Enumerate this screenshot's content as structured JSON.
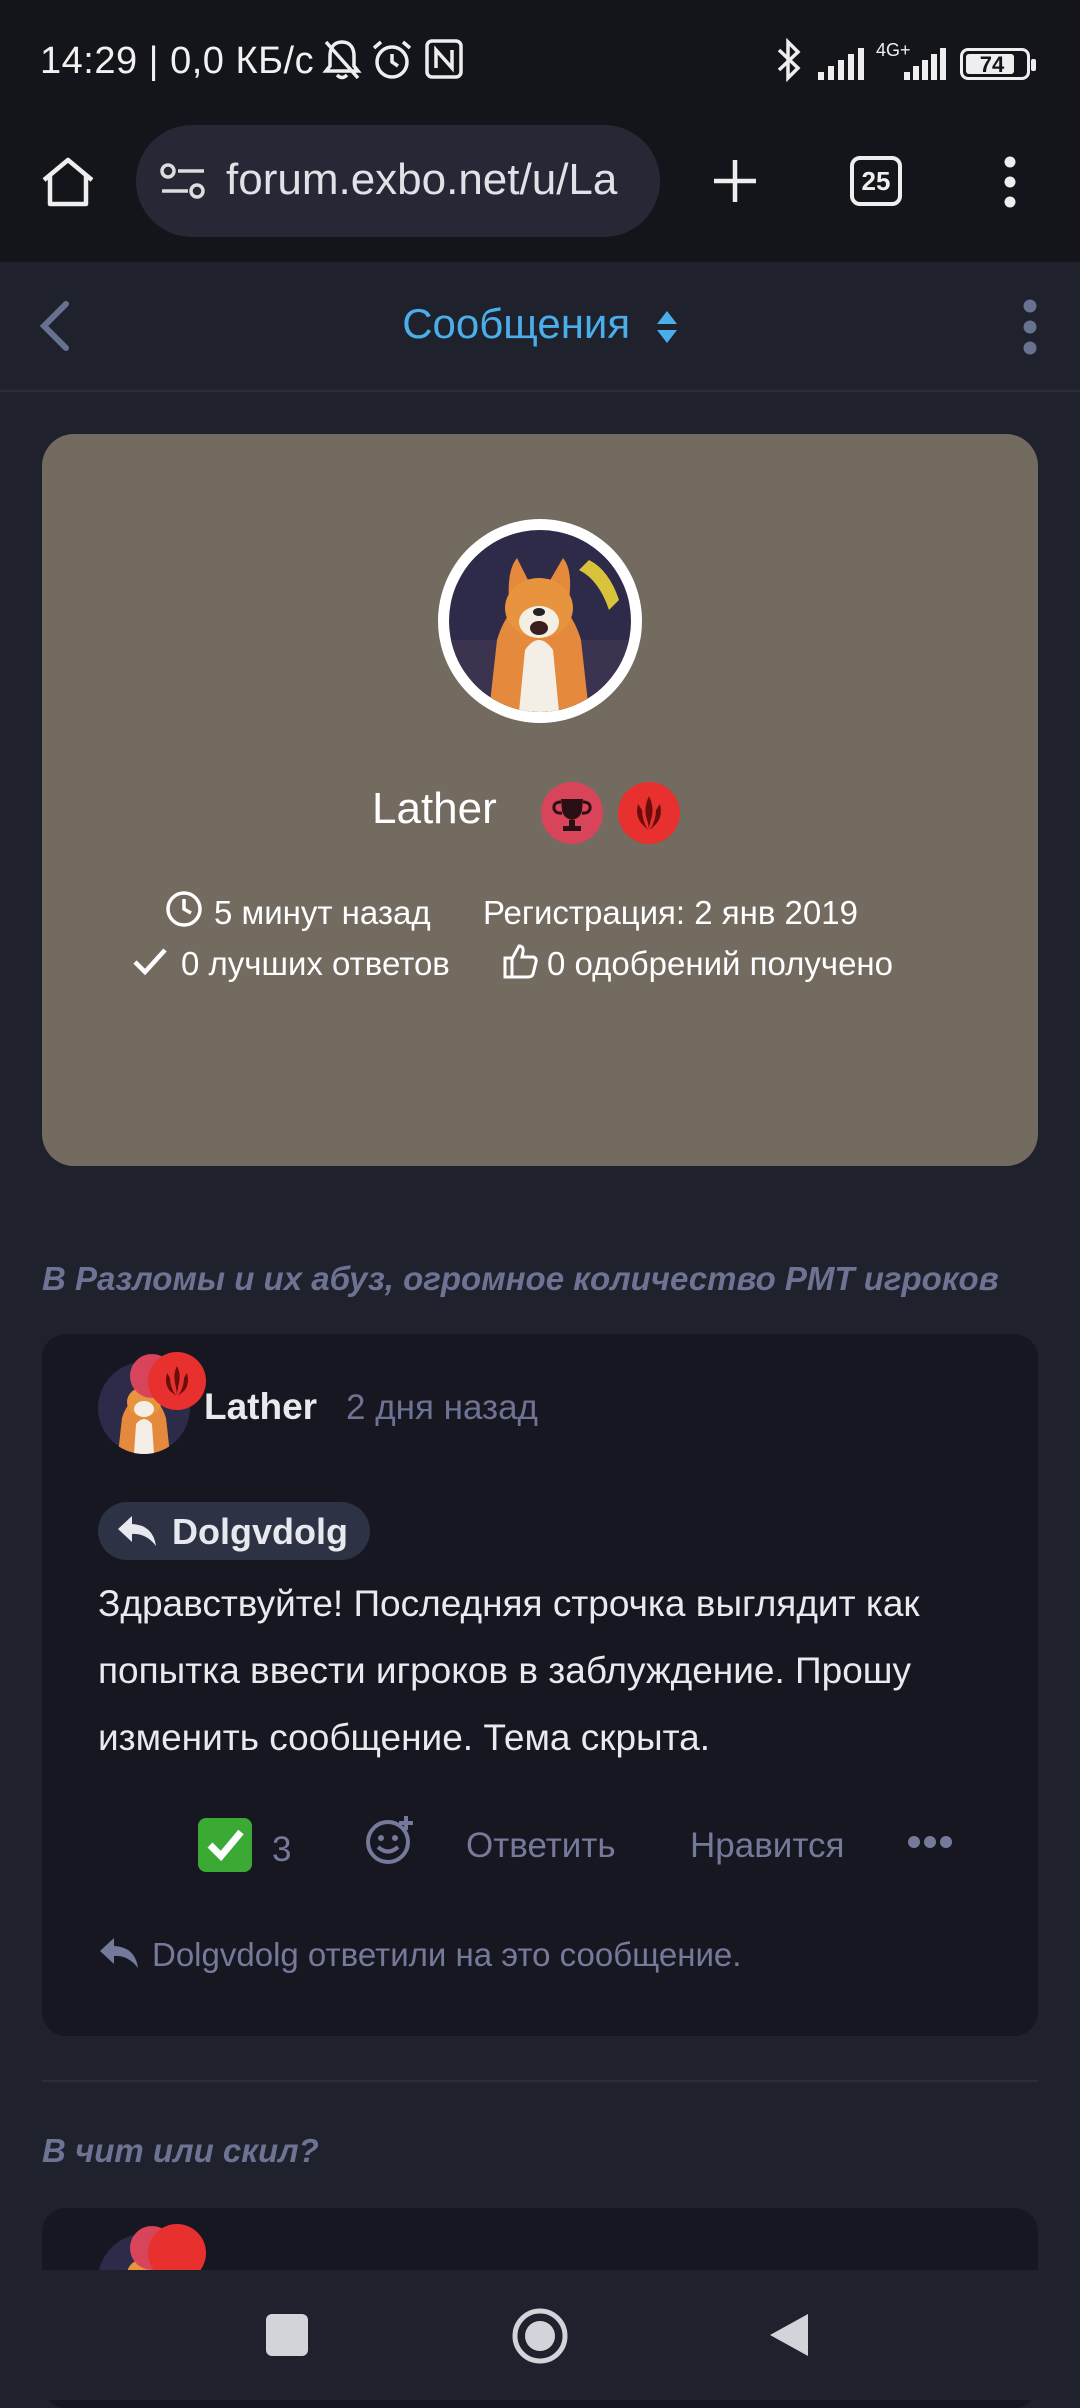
{
  "status_bar": {
    "time_text": "14:29 | 0,0 КБ/с",
    "network": "4G+",
    "battery": "74"
  },
  "browser": {
    "url": "forum.exbo.net/u/La",
    "tab_count": "25"
  },
  "forum_header": {
    "title": "Сообщения"
  },
  "profile": {
    "username": "Lather",
    "last_seen": "5 минут назад",
    "registration": "Регистрация: 2 янв 2019",
    "best_answers": "0 лучших ответов",
    "likes_received": "0 одобрений получено",
    "card_color": "#736a60"
  },
  "posts": [
    {
      "discussion_title": "В Разломы и их абуз, огромное количество РМТ игроков",
      "author": "Lather",
      "time": "2 дня назад",
      "reply_to": "Dolgvdolg",
      "body": "Здравствуйте! Последняя строчка выглядит как попытка ввести игроков в заблуждение. Прошу изменить сообщение. Тема скрыта.",
      "reaction_count": "3",
      "reply_label": "Ответить",
      "like_label": "Нравится",
      "replies_note": "Dolgvdolg ответили на это сообщение."
    },
    {
      "discussion_title": "В чит или скил?"
    }
  ],
  "colors": {
    "accent": "#4aaeea",
    "badge_trophy": "#d8455a",
    "badge_red": "#e8302e"
  }
}
